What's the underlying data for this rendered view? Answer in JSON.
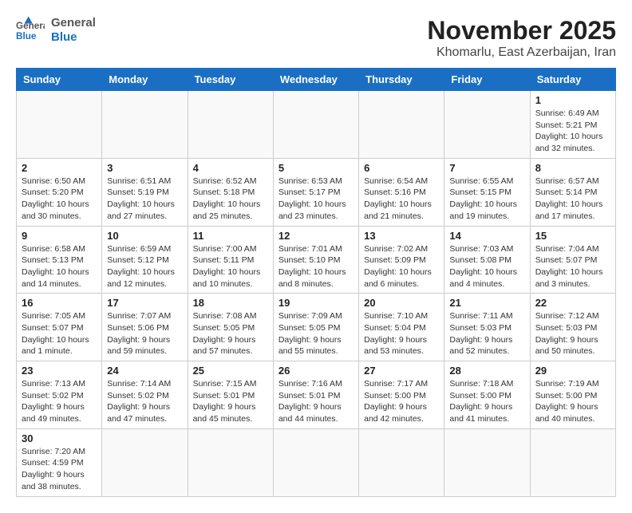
{
  "header": {
    "logo_general": "General",
    "logo_blue": "Blue",
    "month_title": "November 2025",
    "location": "Khomarlu, East Azerbaijan, Iran"
  },
  "weekdays": [
    "Sunday",
    "Monday",
    "Tuesday",
    "Wednesday",
    "Thursday",
    "Friday",
    "Saturday"
  ],
  "weeks": [
    [
      {
        "day": "",
        "info": ""
      },
      {
        "day": "",
        "info": ""
      },
      {
        "day": "",
        "info": ""
      },
      {
        "day": "",
        "info": ""
      },
      {
        "day": "",
        "info": ""
      },
      {
        "day": "",
        "info": ""
      },
      {
        "day": "1",
        "info": "Sunrise: 6:49 AM\nSunset: 5:21 PM\nDaylight: 10 hours\nand 32 minutes."
      }
    ],
    [
      {
        "day": "2",
        "info": "Sunrise: 6:50 AM\nSunset: 5:20 PM\nDaylight: 10 hours\nand 30 minutes."
      },
      {
        "day": "3",
        "info": "Sunrise: 6:51 AM\nSunset: 5:19 PM\nDaylight: 10 hours\nand 27 minutes."
      },
      {
        "day": "4",
        "info": "Sunrise: 6:52 AM\nSunset: 5:18 PM\nDaylight: 10 hours\nand 25 minutes."
      },
      {
        "day": "5",
        "info": "Sunrise: 6:53 AM\nSunset: 5:17 PM\nDaylight: 10 hours\nand 23 minutes."
      },
      {
        "day": "6",
        "info": "Sunrise: 6:54 AM\nSunset: 5:16 PM\nDaylight: 10 hours\nand 21 minutes."
      },
      {
        "day": "7",
        "info": "Sunrise: 6:55 AM\nSunset: 5:15 PM\nDaylight: 10 hours\nand 19 minutes."
      },
      {
        "day": "8",
        "info": "Sunrise: 6:57 AM\nSunset: 5:14 PM\nDaylight: 10 hours\nand 17 minutes."
      }
    ],
    [
      {
        "day": "9",
        "info": "Sunrise: 6:58 AM\nSunset: 5:13 PM\nDaylight: 10 hours\nand 14 minutes."
      },
      {
        "day": "10",
        "info": "Sunrise: 6:59 AM\nSunset: 5:12 PM\nDaylight: 10 hours\nand 12 minutes."
      },
      {
        "day": "11",
        "info": "Sunrise: 7:00 AM\nSunset: 5:11 PM\nDaylight: 10 hours\nand 10 minutes."
      },
      {
        "day": "12",
        "info": "Sunrise: 7:01 AM\nSunset: 5:10 PM\nDaylight: 10 hours\nand 8 minutes."
      },
      {
        "day": "13",
        "info": "Sunrise: 7:02 AM\nSunset: 5:09 PM\nDaylight: 10 hours\nand 6 minutes."
      },
      {
        "day": "14",
        "info": "Sunrise: 7:03 AM\nSunset: 5:08 PM\nDaylight: 10 hours\nand 4 minutes."
      },
      {
        "day": "15",
        "info": "Sunrise: 7:04 AM\nSunset: 5:07 PM\nDaylight: 10 hours\nand 3 minutes."
      }
    ],
    [
      {
        "day": "16",
        "info": "Sunrise: 7:05 AM\nSunset: 5:07 PM\nDaylight: 10 hours\nand 1 minute."
      },
      {
        "day": "17",
        "info": "Sunrise: 7:07 AM\nSunset: 5:06 PM\nDaylight: 9 hours\nand 59 minutes."
      },
      {
        "day": "18",
        "info": "Sunrise: 7:08 AM\nSunset: 5:05 PM\nDaylight: 9 hours\nand 57 minutes."
      },
      {
        "day": "19",
        "info": "Sunrise: 7:09 AM\nSunset: 5:05 PM\nDaylight: 9 hours\nand 55 minutes."
      },
      {
        "day": "20",
        "info": "Sunrise: 7:10 AM\nSunset: 5:04 PM\nDaylight: 9 hours\nand 53 minutes."
      },
      {
        "day": "21",
        "info": "Sunrise: 7:11 AM\nSunset: 5:03 PM\nDaylight: 9 hours\nand 52 minutes."
      },
      {
        "day": "22",
        "info": "Sunrise: 7:12 AM\nSunset: 5:03 PM\nDaylight: 9 hours\nand 50 minutes."
      }
    ],
    [
      {
        "day": "23",
        "info": "Sunrise: 7:13 AM\nSunset: 5:02 PM\nDaylight: 9 hours\nand 49 minutes."
      },
      {
        "day": "24",
        "info": "Sunrise: 7:14 AM\nSunset: 5:02 PM\nDaylight: 9 hours\nand 47 minutes."
      },
      {
        "day": "25",
        "info": "Sunrise: 7:15 AM\nSunset: 5:01 PM\nDaylight: 9 hours\nand 45 minutes."
      },
      {
        "day": "26",
        "info": "Sunrise: 7:16 AM\nSunset: 5:01 PM\nDaylight: 9 hours\nand 44 minutes."
      },
      {
        "day": "27",
        "info": "Sunrise: 7:17 AM\nSunset: 5:00 PM\nDaylight: 9 hours\nand 42 minutes."
      },
      {
        "day": "28",
        "info": "Sunrise: 7:18 AM\nSunset: 5:00 PM\nDaylight: 9 hours\nand 41 minutes."
      },
      {
        "day": "29",
        "info": "Sunrise: 7:19 AM\nSunset: 5:00 PM\nDaylight: 9 hours\nand 40 minutes."
      }
    ],
    [
      {
        "day": "30",
        "info": "Sunrise: 7:20 AM\nSunset: 4:59 PM\nDaylight: 9 hours\nand 38 minutes."
      },
      {
        "day": "",
        "info": ""
      },
      {
        "day": "",
        "info": ""
      },
      {
        "day": "",
        "info": ""
      },
      {
        "day": "",
        "info": ""
      },
      {
        "day": "",
        "info": ""
      },
      {
        "day": "",
        "info": ""
      }
    ]
  ]
}
